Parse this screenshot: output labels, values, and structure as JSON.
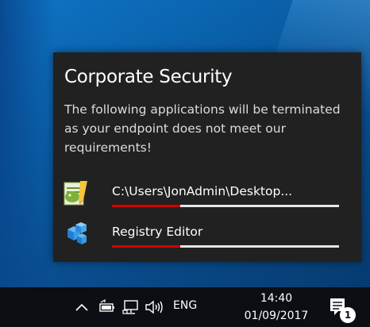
{
  "notification": {
    "title": "Corporate Security",
    "message": "The following applications will be terminated as your endpoint does not meet our requirements!",
    "apps": [
      {
        "name": "C:\\Users\\JonAdmin\\Desktop...",
        "icon": "notepad-plus-plus-icon",
        "progress": 0.3
      },
      {
        "name": "Registry Editor",
        "icon": "registry-editor-icon",
        "progress": 0.3
      }
    ],
    "progress_color": "#d40000"
  },
  "taskbar": {
    "tray_icons": [
      "chevron-up-icon",
      "battery-icon",
      "network-icon",
      "volume-icon"
    ],
    "language": "ENG",
    "time": "14:40",
    "date": "01/09/2017",
    "notification_count": "1"
  }
}
